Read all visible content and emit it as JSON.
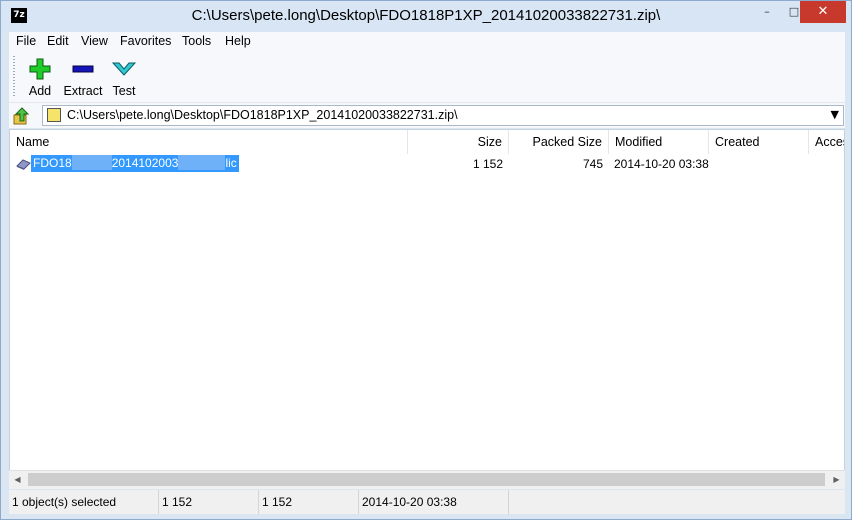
{
  "window": {
    "title": "C:\\Users\\pete.long\\Desktop\\FDO1818P1XP_20141020033822731.zip\\",
    "app_icon_text": "7z",
    "controls": {
      "minimize": "–",
      "maximize": "□",
      "close": "✕"
    }
  },
  "menu": [
    "File",
    "Edit",
    "View",
    "Favorites",
    "Tools",
    "Help"
  ],
  "toolbar": {
    "add_label": "Add",
    "extract_label": "Extract",
    "test_label": "Test"
  },
  "address": {
    "path": "C:\\Users\\pete.long\\Desktop\\FDO1818P1XP_20141020033822731.zip\\",
    "dropdown_glyph": "▼"
  },
  "columns": [
    "Name",
    "Size",
    "Packed Size",
    "Modified",
    "Created",
    "Acces"
  ],
  "files": [
    {
      "name_part1": "FDO18",
      "name_part2": "2014102003",
      "name_part3": "lic",
      "size": "1 152",
      "packed_size": "745",
      "modified": "2014-10-20 03:38",
      "selected": true
    }
  ],
  "scrollbar": {
    "left_arrow": "◀",
    "right_arrow": "▶"
  },
  "status": {
    "selection": "1 object(s) selected",
    "size": "1 152",
    "packed": "1 152",
    "modified": "2014-10-20 03:38"
  },
  "colors": {
    "selection": "#3399ff",
    "add_icon": "#1fcc2a",
    "extract_icon": "#1414b8",
    "test_icon": "#31c8d2"
  }
}
